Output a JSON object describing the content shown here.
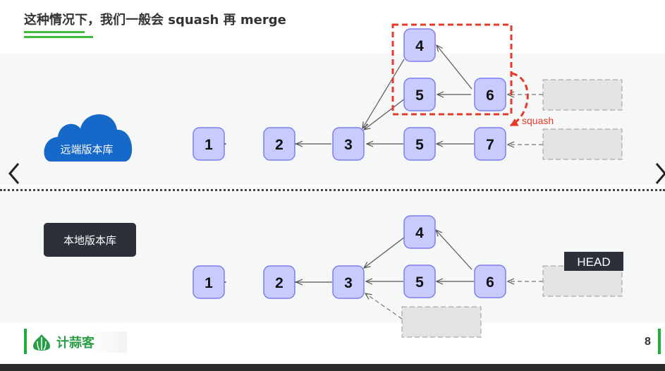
{
  "slide": {
    "title": "这种情况下，我们一般会 squash 再 merge",
    "page_number": "8"
  },
  "remote": {
    "label": "远端版本库",
    "commits": [
      "1",
      "2",
      "3",
      "5",
      "7"
    ],
    "branch_commits": [
      "4",
      "5",
      "6"
    ],
    "squash_label": "squash"
  },
  "local": {
    "label": "本地版本库",
    "commits": [
      "1",
      "2",
      "3"
    ],
    "branch_commits": [
      "4",
      "5",
      "6"
    ],
    "head_label": "HEAD"
  },
  "footer": {
    "logo_text": "计蒜客"
  },
  "colors": {
    "node_fill": "#c9cbff",
    "node_stroke": "#7b7ff0",
    "cloud": "#1769c9",
    "squash_red": "#e53b2c",
    "accent_green": "#3dbd3d"
  }
}
